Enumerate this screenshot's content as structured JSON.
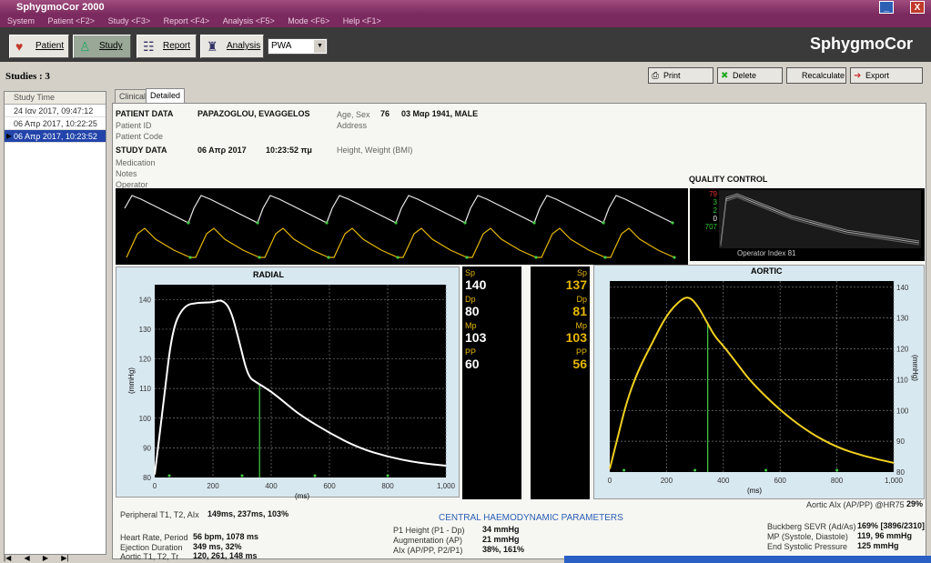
{
  "app": {
    "title": "SphygmoCor 2000",
    "brand": "SphygmoCor",
    "menu": [
      "System",
      "Patient <F2>",
      "Study <F3>",
      "Report <F4>",
      "Analysis <F5>",
      "Mode <F6>",
      "Help <F1>"
    ],
    "window_buttons": [
      "_",
      "X"
    ]
  },
  "toolbar": {
    "patient_label": "Patient",
    "study_label": "Study",
    "report_label": "Report",
    "analysis_label": "Analysis",
    "mode_value": "PWA"
  },
  "studies_bar": {
    "label": "Studies : 3",
    "print_label": "Print",
    "delete_label": "Delete",
    "recalculate_label": "Recalculate",
    "export_label": "Export"
  },
  "study_list": {
    "header": "Study Time",
    "rows": [
      "24 Ιαν 2017, 09:47:12",
      "06 Απρ 2017, 10:22:25",
      "06 Απρ 2017, 10:23:52"
    ],
    "selected_index": 2
  },
  "tabs": [
    "Clinical",
    "Detailed"
  ],
  "patient": {
    "heading": "PATIENT DATA",
    "name": "PAPAZOGLOU, EVAGGELOS",
    "id_label": "Patient ID",
    "code_label": "Patient Code",
    "age_sex_label": "Age, Sex",
    "age": "76",
    "dob_sex": "03 Μαρ 1941, MALE",
    "address_label": "Address"
  },
  "study": {
    "heading": "STUDY DATA",
    "date": "06 Απρ 2017",
    "time": "10:23:52 πμ",
    "height_weight_label": "Height, Weight (BMI)",
    "medication_label": "Medication",
    "notes_label": "Notes",
    "operator_label": "Operator"
  },
  "quality_control": {
    "title": "QUALITY CONTROL",
    "values": [
      "79",
      "3",
      "2",
      "0",
      "707"
    ],
    "operator_index": "Operator Index  81"
  },
  "radial": {
    "title": "RADIAL",
    "ylabel": "(mmHg)",
    "xlabel": "(ms)",
    "readout": {
      "sp_label": "Sp",
      "sp": "140",
      "dp_label": "Dp",
      "dp": "80",
      "mp_label": "Mp",
      "mp": "103",
      "pp_label": "PP",
      "pp": "60"
    }
  },
  "aortic": {
    "title": "AORTIC",
    "ylabel": "(mmHg)",
    "xlabel": "(ms)",
    "readout": {
      "sp_label": "Sp",
      "sp": "137",
      "dp_label": "Dp",
      "dp": "81",
      "mp_label": "Mp",
      "mp": "103",
      "pp_label": "PP",
      "pp": "56"
    }
  },
  "chart_data": [
    {
      "type": "line",
      "title": "RADIAL",
      "xlabel": "(ms)",
      "ylabel": "(mmHg)",
      "xlim": [
        0,
        1000
      ],
      "ylim": [
        80,
        145
      ],
      "xticks": [
        "0",
        "200",
        "400",
        "600",
        "800",
        "1,000"
      ],
      "yticks": [
        "80",
        "90",
        "100",
        "110",
        "120",
        "130",
        "140"
      ],
      "grid": true,
      "series": [
        {
          "x": [
            0,
            30,
            60,
            100,
            150,
            200,
            230,
            260,
            290,
            320,
            350,
            400,
            450,
            500,
            600,
            700,
            800,
            900,
            1000
          ],
          "y": [
            81,
            105,
            130,
            138,
            139,
            139,
            140,
            137,
            126,
            114,
            112,
            109,
            105,
            101,
            95,
            90,
            87,
            85,
            84
          ]
        }
      ],
      "marker_x": 360,
      "color": "#ffffff"
    },
    {
      "type": "line",
      "title": "AORTIC",
      "xlabel": "(ms)",
      "ylabel": "(mmHg)",
      "xlim": [
        0,
        1000
      ],
      "ylim": [
        80,
        142
      ],
      "xticks": [
        "0",
        "200",
        "400",
        "600",
        "800",
        "1,000"
      ],
      "yticks": [
        "80",
        "90",
        "100",
        "110",
        "120",
        "130",
        "140"
      ],
      "grid": true,
      "series": [
        {
          "x": [
            0,
            30,
            60,
            100,
            150,
            200,
            250,
            280,
            310,
            340,
            370,
            400,
            450,
            500,
            600,
            700,
            800,
            900,
            1000
          ],
          "y": [
            81,
            92,
            103,
            113,
            122,
            131,
            136,
            137,
            134,
            129,
            124,
            121,
            115,
            109,
            100,
            93,
            88,
            85,
            83
          ]
        }
      ],
      "marker_x": 345,
      "color": "#f0d020"
    }
  ],
  "bottom": {
    "peripheral_label": "Peripheral T1, T2, AIx",
    "peripheral_value": "149ms, 237ms, 103%",
    "heart_rate_label": "Heart Rate, Period",
    "heart_rate_value": "56 bpm, 1078 ms",
    "ejection_label": "Ejection Duration",
    "ejection_value": "349 ms, 32%",
    "aortic_t_label": "Aortic T1, T2, Tr",
    "aortic_t_value": "120, 261, 148 ms",
    "central_title": "CENTRAL HAEMODYNAMIC PARAMETERS",
    "p1_label": "P1 Height (P1 - Dp)",
    "p1_value": "34 mmHg",
    "aug_label": "Augmentation (AP)",
    "aug_value": "21 mmHg",
    "aix_label": "AIx (AP/PP, P2/P1)",
    "aix_value": "38%, 161%",
    "aortic_aix_label": "Aortic AIx (AP/PP) @HR75",
    "aortic_aix_value": "29%",
    "buckberg_label": "Buckberg SEVR (Ad/As)",
    "buckberg_value": "169% [3896/2310]",
    "mp_label": "MP (Systole, Diastole)",
    "mp_value": "119, 96 mmHg",
    "esp_label": "End Systolic Pressure",
    "esp_value": "125 mmHg"
  }
}
